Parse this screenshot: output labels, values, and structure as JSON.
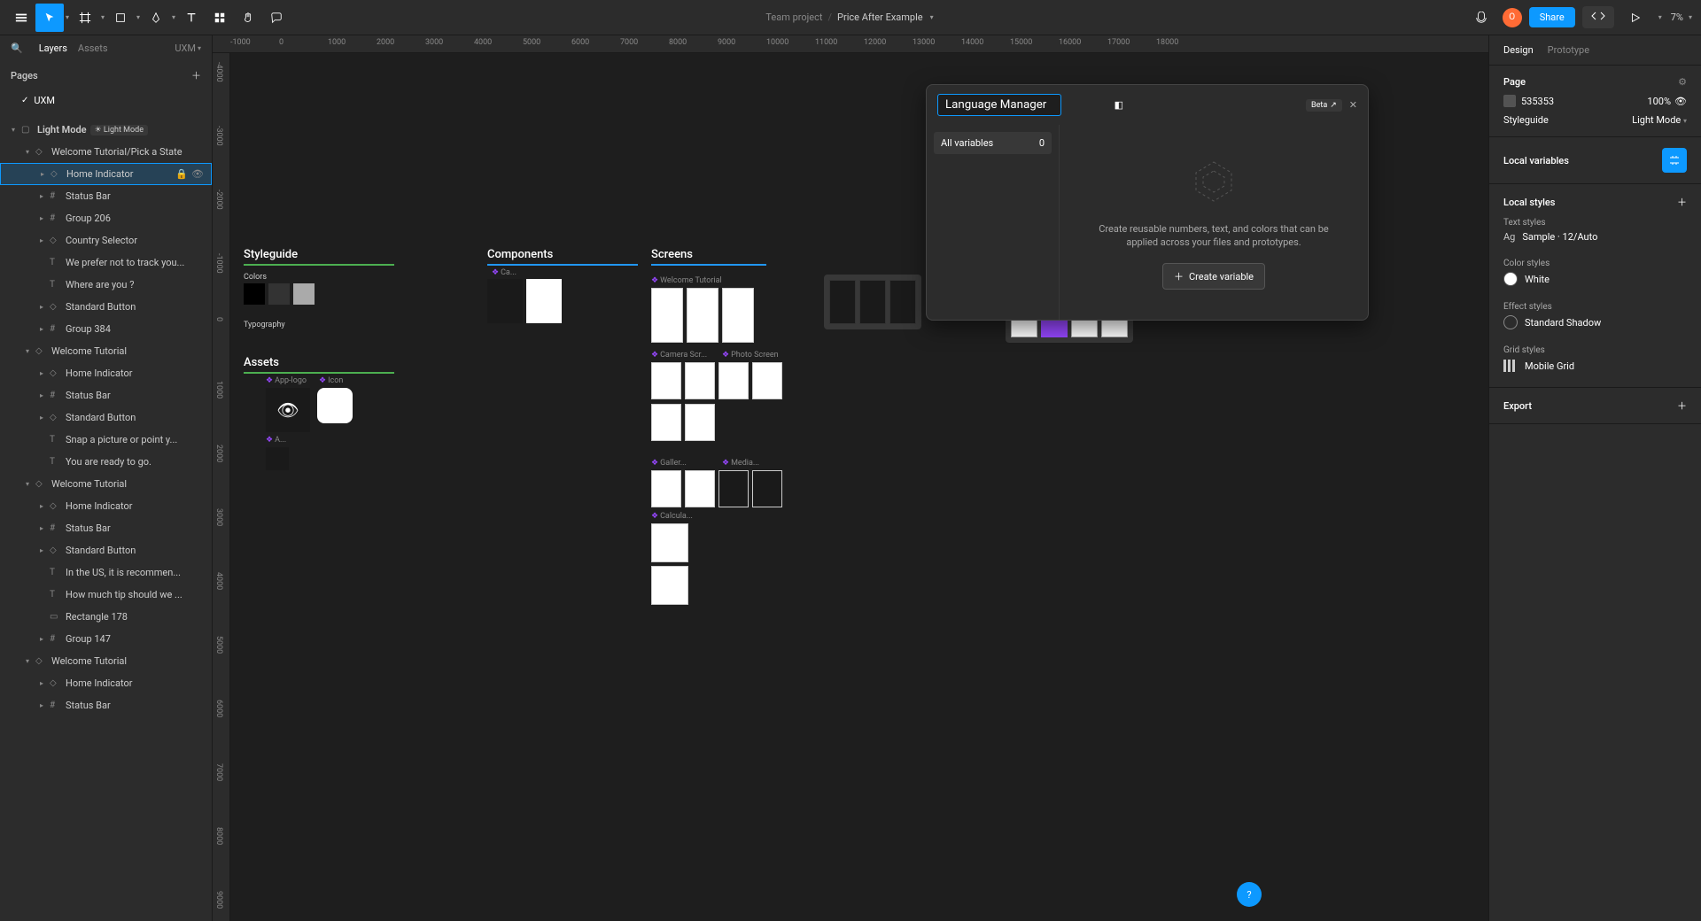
{
  "breadcrumb": {
    "project": "Team project",
    "file": "Price After Example"
  },
  "topbar": {
    "share": "Share",
    "zoom": "7%"
  },
  "avatar_letter": "O",
  "left_panel": {
    "tabs": {
      "layers": "Layers",
      "assets": "Assets"
    },
    "page_selector": "UXM",
    "pages_hdr": "Pages",
    "page_name": "UXM",
    "light_mode_hdr": "Light Mode",
    "light_mode_badge": "Light Mode",
    "layers": [
      {
        "depth": 1,
        "icon": "◇",
        "txt": "Welcome Tutorial/Pick a State",
        "caret": "▾",
        "selected": false
      },
      {
        "depth": 2,
        "icon": "◇",
        "txt": "Home Indicator",
        "caret": "▸",
        "selected": true,
        "lock": true,
        "eye": true
      },
      {
        "depth": 2,
        "icon": "#",
        "txt": "Status Bar",
        "caret": "▸"
      },
      {
        "depth": 2,
        "icon": "#",
        "txt": "Group 206",
        "caret": "▸"
      },
      {
        "depth": 2,
        "icon": "◇",
        "txt": "Country Selector",
        "caret": "▸"
      },
      {
        "depth": 2,
        "icon": "T",
        "txt": "We prefer not to track you..."
      },
      {
        "depth": 2,
        "icon": "T",
        "txt": "Where are you ?"
      },
      {
        "depth": 2,
        "icon": "◇",
        "txt": "Standard Button",
        "caret": "▸"
      },
      {
        "depth": 2,
        "icon": "#",
        "txt": "Group 384",
        "caret": "▸"
      },
      {
        "depth": 1,
        "icon": "◇",
        "txt": "Welcome Tutorial",
        "caret": "▾"
      },
      {
        "depth": 2,
        "icon": "◇",
        "txt": "Home Indicator",
        "caret": "▸"
      },
      {
        "depth": 2,
        "icon": "#",
        "txt": "Status Bar",
        "caret": "▸"
      },
      {
        "depth": 2,
        "icon": "◇",
        "txt": "Standard Button",
        "caret": "▸"
      },
      {
        "depth": 2,
        "icon": "T",
        "txt": "Snap a picture or point y..."
      },
      {
        "depth": 2,
        "icon": "T",
        "txt": "You are ready to go."
      },
      {
        "depth": 1,
        "icon": "◇",
        "txt": "Welcome Tutorial",
        "caret": "▾"
      },
      {
        "depth": 2,
        "icon": "◇",
        "txt": "Home Indicator",
        "caret": "▸"
      },
      {
        "depth": 2,
        "icon": "#",
        "txt": "Status Bar",
        "caret": "▸"
      },
      {
        "depth": 2,
        "icon": "◇",
        "txt": "Standard Button",
        "caret": "▸"
      },
      {
        "depth": 2,
        "icon": "T",
        "txt": "In the US, it is recommen..."
      },
      {
        "depth": 2,
        "icon": "T",
        "txt": "How much tip should we ..."
      },
      {
        "depth": 2,
        "icon": "▭",
        "txt": "Rectangle 178"
      },
      {
        "depth": 2,
        "icon": "#",
        "txt": "Group 147",
        "caret": "▸"
      },
      {
        "depth": 1,
        "icon": "◇",
        "txt": "Welcome Tutorial",
        "caret": "▾"
      },
      {
        "depth": 2,
        "icon": "◇",
        "txt": "Home Indicator",
        "caret": "▸"
      },
      {
        "depth": 2,
        "icon": "#",
        "txt": "Status Bar",
        "caret": "▸"
      }
    ]
  },
  "ruler_h": [
    -1000,
    0,
    1000,
    2000,
    3000,
    4000,
    5000,
    6000,
    7000,
    8000,
    9000,
    10000,
    11000,
    12000,
    13000,
    14000,
    15000,
    16000,
    17000,
    18000
  ],
  "ruler_v": [
    -4000,
    -3000,
    -2000,
    -1000,
    0,
    1000,
    2000,
    3000,
    4000,
    5000,
    6000,
    7000,
    8000,
    9000
  ],
  "canvas": {
    "sections": {
      "styleguide": "Styleguide",
      "components": "Components",
      "screens": "Screens",
      "assets": "Assets",
      "colors": "Colors",
      "typography": "Typography"
    },
    "frame_labels": {
      "ca": "Ca...",
      "app_logo": "App-logo",
      "icon": "Icon",
      "a": "A...",
      "welcome": "Welcome Tutorial",
      "camera": "Camera Scr...",
      "photo": "Photo Screen",
      "galler": "Galler...",
      "media": "Media...",
      "calcula": "Calcula..."
    }
  },
  "modal": {
    "name_input": "Language Manager",
    "all_vars": "All variables",
    "count": "0",
    "beta": "Beta",
    "empty_msg": "Create reusable numbers, text, and colors that can be applied across your files and prototypes.",
    "create_btn": "Create variable"
  },
  "right_panel": {
    "tabs": {
      "design": "Design",
      "prototype": "Prototype"
    },
    "page_hdr": "Page",
    "bg_color": "535353",
    "zoom": "100%",
    "styleguide_lbl": "Styleguide",
    "styleguide_val": "Light Mode",
    "local_vars": "Local variables",
    "local_styles": "Local styles",
    "text_styles": "Text styles",
    "sample": "Sample · 12/Auto",
    "color_styles": "Color styles",
    "white": "White",
    "effect_styles": "Effect styles",
    "shadow": "Standard Shadow",
    "grid_styles": "Grid styles",
    "mobile_grid": "Mobile Grid",
    "export": "Export"
  }
}
